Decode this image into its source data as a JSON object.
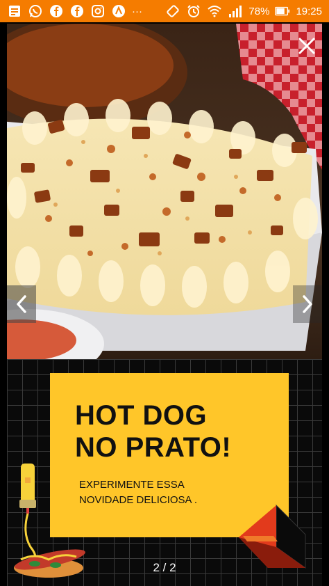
{
  "status_bar": {
    "battery": "78%",
    "time": "19:25",
    "more": "···",
    "icons": [
      "notes-icon",
      "whatsapp-icon",
      "facebook-icon",
      "facebook-icon",
      "instagram-icon",
      "app-a-icon",
      "more-icon",
      "rotate-icon",
      "alarm-icon",
      "wifi-icon",
      "signal-icon",
      "battery-icon"
    ]
  },
  "viewer": {
    "photo": {
      "description_icon": "food-photo-image"
    },
    "controls": {
      "close_icon": "close-icon",
      "prev_icon": "chevron-left-icon",
      "next_icon": "chevron-right-icon"
    },
    "page_indicator": "2 / 2"
  },
  "ad": {
    "title_line1": "HOT DOG",
    "title_line2": "NO PRATO!",
    "subtitle_line1": "EXPERIMENTE ESSA",
    "subtitle_line2": "NOVIDADE DELICIOSA .",
    "colors": {
      "panel": "#ffc629",
      "grid": "#3a3a3a",
      "background": "#0a0a0a"
    }
  },
  "colors": {
    "status_bar": "#f57c00"
  }
}
